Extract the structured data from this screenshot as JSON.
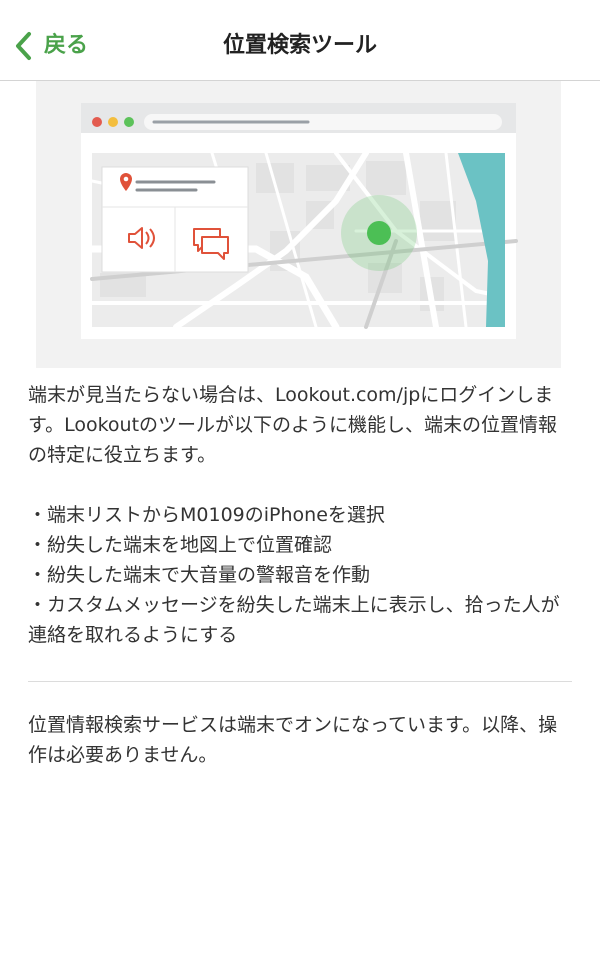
{
  "nav": {
    "back_label": "戻る",
    "title": "位置検索ツール"
  },
  "illustration": {
    "location_pin_color": "#e0523a",
    "dot_color": "#4cbf55",
    "water_color": "#6bc2c4"
  },
  "content": {
    "intro": "端末が見当たらない場合は、Lookout.com/jpにログインします。Lookoutのツールが以下のように機能し、端末の位置情報の特定に役立ちます。",
    "bullets": [
      "・端末リストからM0109のiPhoneを選択",
      "・紛失した端末を地図上で位置確認",
      "・紛失した端末で大音量の警報音を作動",
      "・カスタムメッセージを紛失した端末上に表示し、拾った人が連絡を取れるようにする"
    ],
    "footer": "位置情報検索サービスは端末でオンになっています。以降、操作は必要ありません。"
  },
  "colors": {
    "accent": "#4aa24a",
    "text": "#333333"
  }
}
